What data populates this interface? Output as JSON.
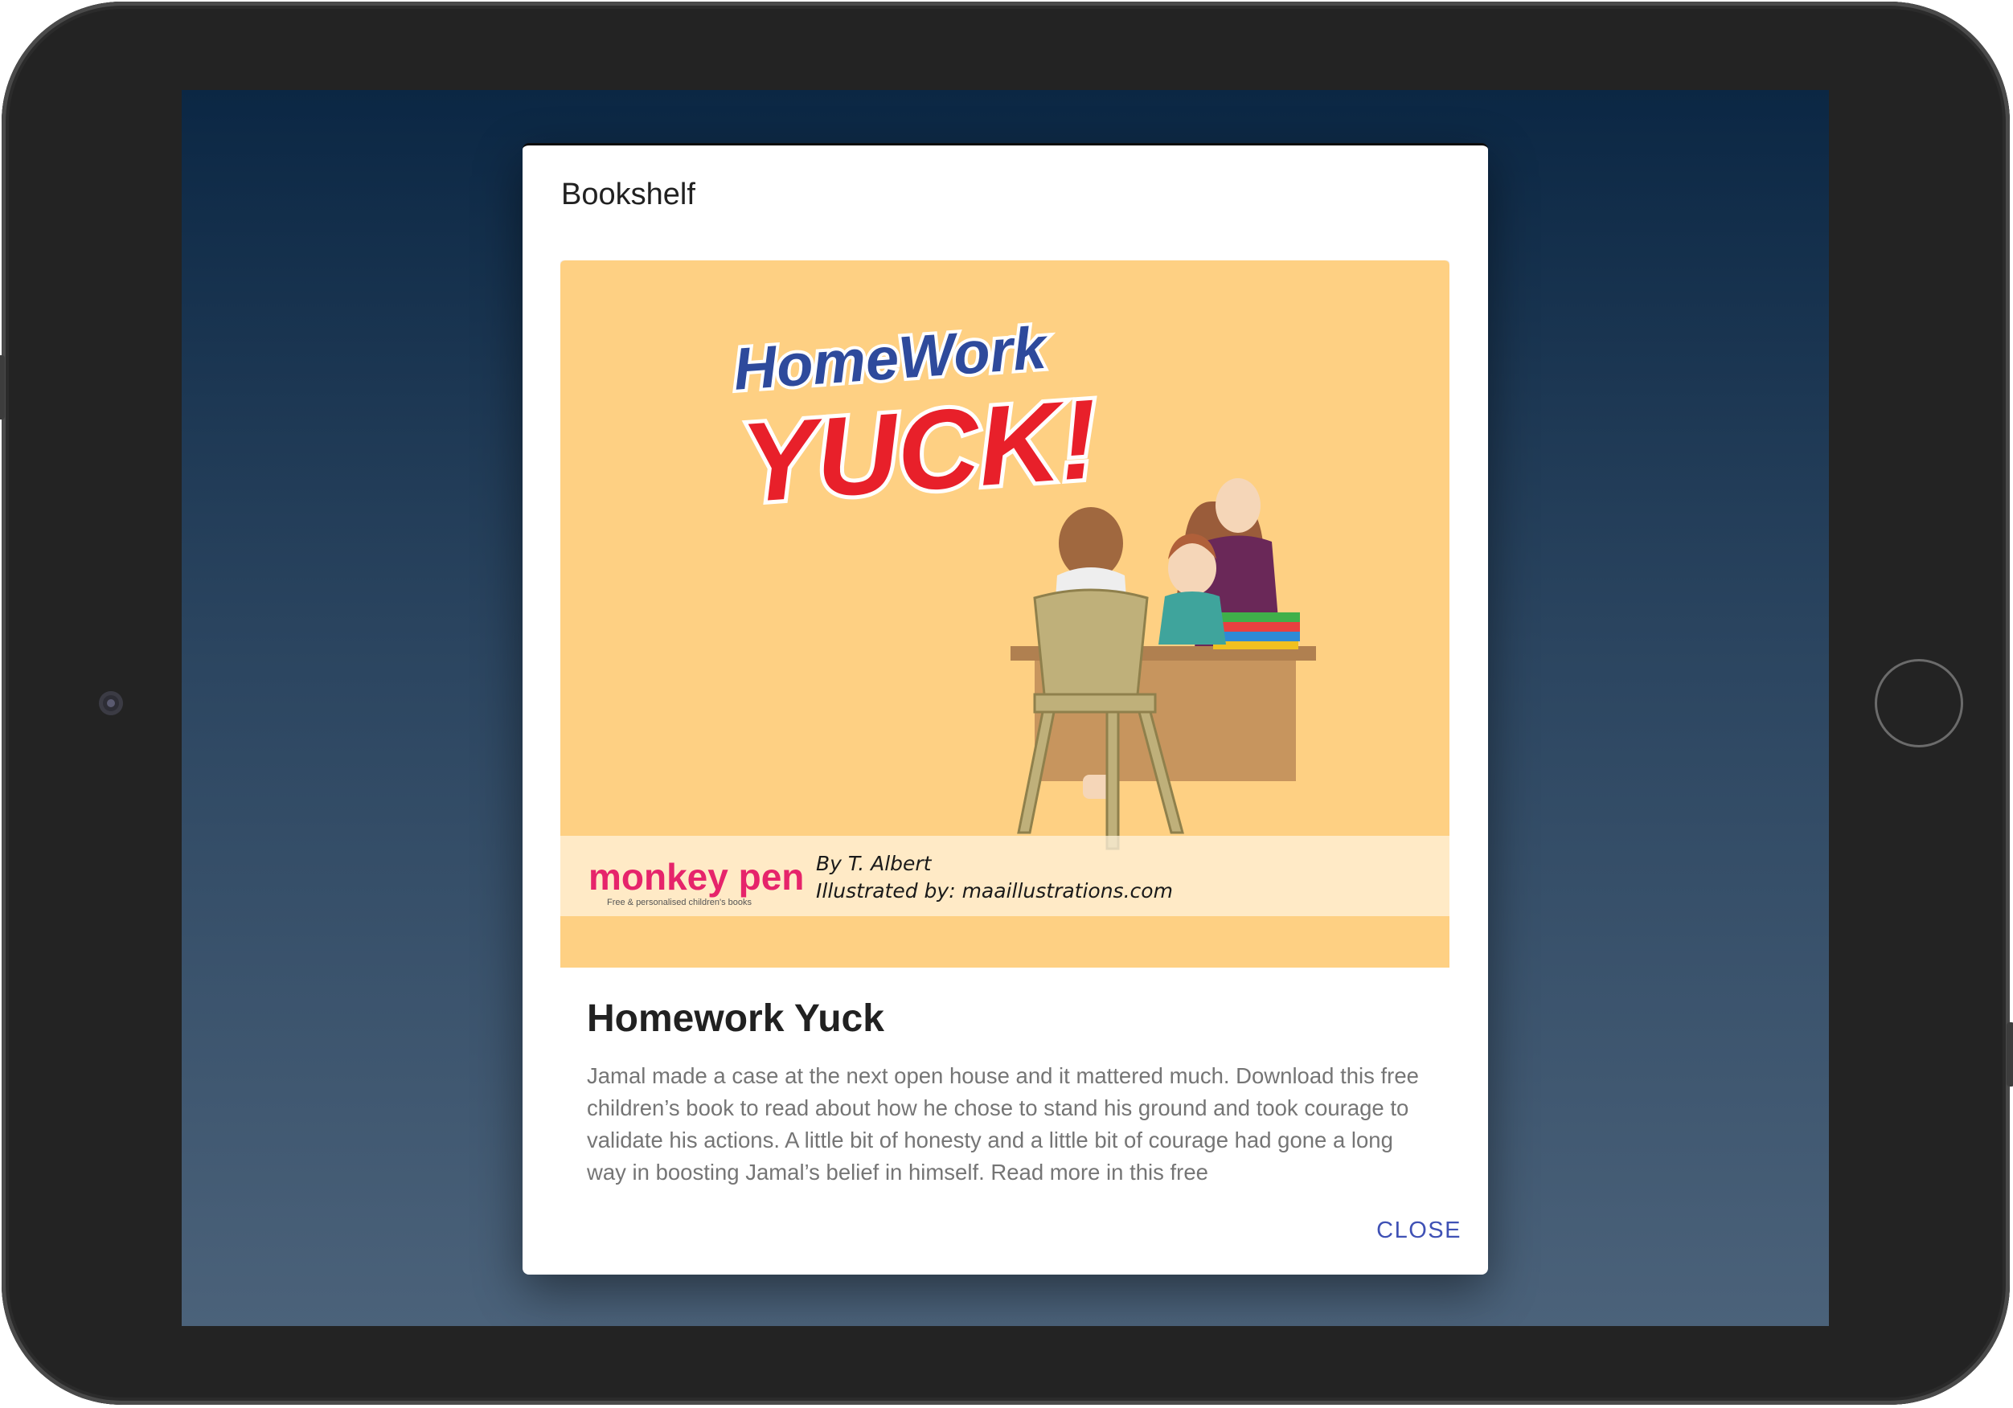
{
  "dialog": {
    "title": "Bookshelf",
    "close_label": "CLOSE"
  },
  "book": {
    "title": "Homework Yuck",
    "description": "Jamal made a case at the next open house and it mattered much. Download this free children’s book to read about how he chose to stand his ground and took courage to validate his actions. A little bit of honesty and a little bit of courage had gone a long way in boosting Jamal’s belief in himself. Read more in this free",
    "cover": {
      "title_line1": "HomeWork",
      "title_line2": "YUCK!",
      "publisher_logo": "monkey pen",
      "publisher_tagline": "Free & personalised children's books",
      "author_line": "By T. Albert",
      "illustrator_line": "Illustrated by: maaillustrations.com",
      "background_color": "#fed083",
      "title_red": "#e8202a",
      "title_blue": "#2e4a9c"
    }
  },
  "colors": {
    "accent": "#3f51b5",
    "screen_top": "#0b2744",
    "screen_bottom": "#4b627a"
  }
}
